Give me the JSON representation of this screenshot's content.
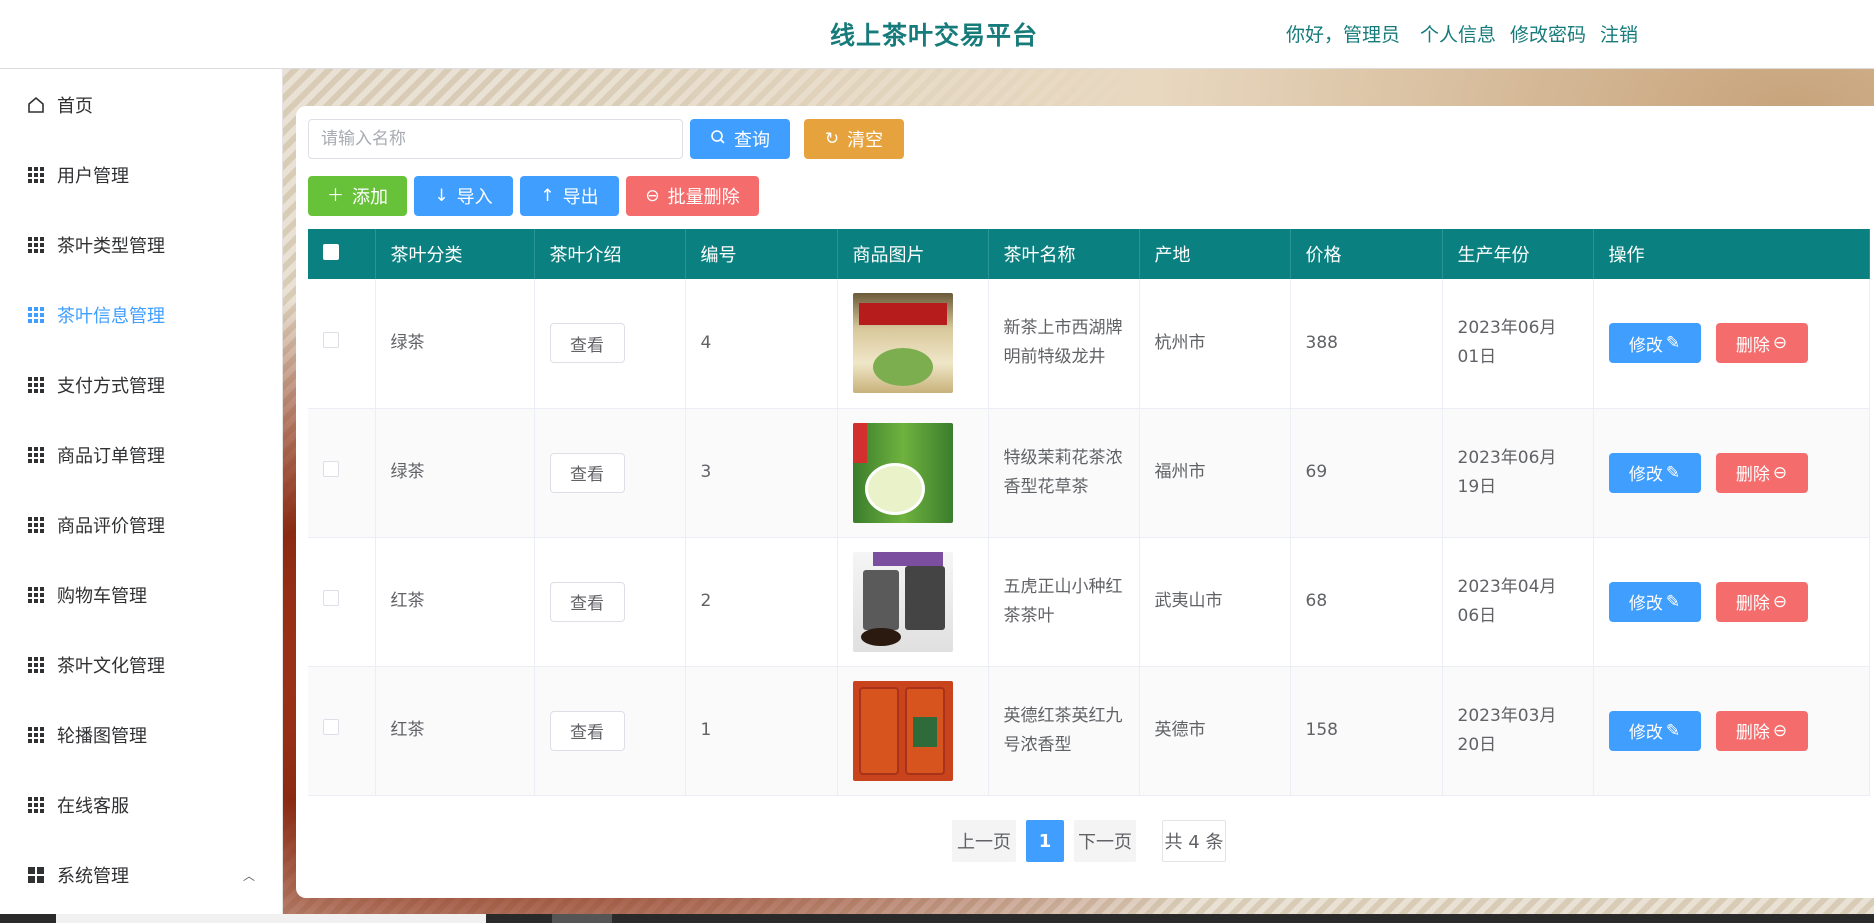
{
  "header": {
    "title": "线上茶叶交易平台",
    "greeting": "你好，管理员",
    "profile": "个人信息",
    "change_password": "修改密码",
    "logout": "注销"
  },
  "sidebar": {
    "items": [
      {
        "label": "首页",
        "icon": "home-icon"
      },
      {
        "label": "用户管理",
        "icon": "grid-icon"
      },
      {
        "label": "茶叶类型管理",
        "icon": "grid-icon"
      },
      {
        "label": "茶叶信息管理",
        "icon": "grid-icon",
        "active": true
      },
      {
        "label": "支付方式管理",
        "icon": "grid-icon"
      },
      {
        "label": "商品订单管理",
        "icon": "grid-icon"
      },
      {
        "label": "商品评价管理",
        "icon": "grid-icon"
      },
      {
        "label": "购物车管理",
        "icon": "grid-icon"
      },
      {
        "label": "茶叶文化管理",
        "icon": "grid-icon"
      },
      {
        "label": "轮播图管理",
        "icon": "grid-icon"
      },
      {
        "label": "在线客服",
        "icon": "grid-icon"
      },
      {
        "label": "系统管理",
        "icon": "grid4-icon",
        "expanded": true
      }
    ]
  },
  "toolbar": {
    "search_placeholder": "请输入名称",
    "query": "查询",
    "clear": "清空",
    "add": "添加",
    "import": "导入",
    "export": "导出",
    "batch_delete": "批量删除"
  },
  "table": {
    "columns": [
      "茶叶分类",
      "茶叶介绍",
      "编号",
      "商品图片",
      "茶叶名称",
      "产地",
      "价格",
      "生产年份",
      "操作"
    ],
    "view_label": "查看",
    "edit_label": "修改",
    "delete_label": "删除",
    "rows": [
      {
        "category": "绿茶",
        "id": "4",
        "name": "新茶上市西湖牌明前特级龙井",
        "origin": "杭州市",
        "price": "388",
        "year": "2023年06月01日",
        "image": "longjing-tea"
      },
      {
        "category": "绿茶",
        "id": "3",
        "name": "特级茉莉花茶浓香型花草茶",
        "origin": "福州市",
        "price": "69",
        "year": "2023年06月19日",
        "image": "jasmine-tea"
      },
      {
        "category": "红茶",
        "id": "2",
        "name": "五虎正山小种红茶茶叶",
        "origin": "武夷山市",
        "price": "68",
        "year": "2023年04月06日",
        "image": "lapsang-tea"
      },
      {
        "category": "红茶",
        "id": "1",
        "name": "英德红茶英红九号浓香型",
        "origin": "英德市",
        "price": "158",
        "year": "2023年03月20日",
        "image": "yingde-tea"
      }
    ]
  },
  "pagination": {
    "prev": "上一页",
    "current": "1",
    "next": "下一页",
    "total": "共 4 条"
  },
  "colors": {
    "accent": "#409eff",
    "header_teal": "#0b8080",
    "title_teal": "#177b7b"
  }
}
